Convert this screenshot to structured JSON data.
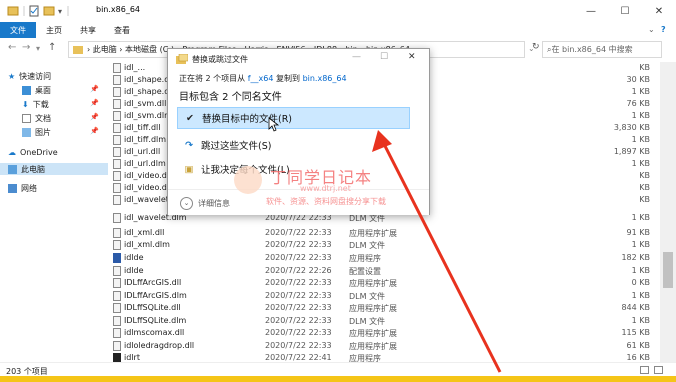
{
  "window": {
    "title": "bin.x86_64",
    "controls": {
      "minimize": "—",
      "maximize": "☐",
      "close": "✕"
    }
  },
  "ribbon": {
    "file_tab": "文件",
    "tabs": [
      "主页",
      "共享",
      "查看"
    ]
  },
  "address": {
    "path": "› 此电脑 › 本地磁盘 (C:) › Program Files › Harris › ENVI56 › IDL88 › bin › bin.x86_64",
    "search_placeholder": "在 bin.x86_64 中搜索"
  },
  "sidebar": {
    "items": [
      {
        "label": "快速访问",
        "icon": "star-icon"
      },
      {
        "label": "桌面",
        "icon": "desktop-icon"
      },
      {
        "label": "下载",
        "icon": "download-icon"
      },
      {
        "label": "文档",
        "icon": "document-icon"
      },
      {
        "label": "图片",
        "icon": "picture-icon"
      },
      {
        "label": "OneDrive",
        "icon": "cloud-icon"
      },
      {
        "label": "此电脑",
        "icon": "computer-icon"
      },
      {
        "label": "网络",
        "icon": "network-icon"
      }
    ],
    "pin_glyph": "📌"
  },
  "files": [
    {
      "name": "idl_...",
      "date": "",
      "type": "",
      "size": "KB"
    },
    {
      "name": "idl_shape.dll",
      "date": "",
      "type": "",
      "size": "30 KB"
    },
    {
      "name": "idl_shape.dlm",
      "date": "",
      "type": "",
      "size": "1 KB"
    },
    {
      "name": "idl_svm.dll",
      "date": "",
      "type": "",
      "size": "76 KB"
    },
    {
      "name": "idl_svm.dlm",
      "date": "",
      "type": "",
      "size": "1 KB"
    },
    {
      "name": "idl_tiff.dll",
      "date": "",
      "type": "",
      "size": "3,830 KB"
    },
    {
      "name": "idl_tiff.dlm",
      "date": "",
      "type": "",
      "size": "1 KB"
    },
    {
      "name": "idl_url.dll",
      "date": "",
      "type": "",
      "size": "1,897 KB"
    },
    {
      "name": "idl_url.dlm",
      "date": "",
      "type": "",
      "size": "1 KB"
    },
    {
      "name": "idl_video.dll",
      "date": "",
      "type": "",
      "size": "KB"
    },
    {
      "name": "idl_video.dlm",
      "date": "",
      "type": "",
      "size": "KB"
    },
    {
      "name": "idl_wavelet...",
      "date": "",
      "type": "",
      "size": "KB"
    },
    {
      "name": "idl_wavelet.dlm",
      "date": "2020/7/22 22:33",
      "type": "DLM 文件",
      "size": "1 KB"
    },
    {
      "name": "idl_xml.dll",
      "date": "2020/7/22 22:33",
      "type": "应用程序扩展",
      "size": "91 KB"
    },
    {
      "name": "idl_xml.dlm",
      "date": "2020/7/22 22:33",
      "type": "DLM 文件",
      "size": "1 KB"
    },
    {
      "name": "idlde",
      "date": "2020/7/22 22:33",
      "type": "应用程序",
      "size": "182 KB"
    },
    {
      "name": "idlde",
      "date": "2020/7/22 22:26",
      "type": "配置设置",
      "size": "1 KB"
    },
    {
      "name": "IDLffArcGIS.dll",
      "date": "2020/7/22 22:33",
      "type": "应用程序扩展",
      "size": "0 KB"
    },
    {
      "name": "IDLffArcGIS.dlm",
      "date": "2020/7/22 22:33",
      "type": "DLM 文件",
      "size": "1 KB"
    },
    {
      "name": "IDLffSQLite.dll",
      "date": "2020/7/22 22:33",
      "type": "应用程序扩展",
      "size": "844 KB"
    },
    {
      "name": "IDLffSQLite.dlm",
      "date": "2020/7/22 22:33",
      "type": "DLM 文件",
      "size": "1 KB"
    },
    {
      "name": "idlmscomax.dll",
      "date": "2020/7/22 22:33",
      "type": "应用程序扩展",
      "size": "115 KB"
    },
    {
      "name": "idloledragdrop.dll",
      "date": "2020/7/22 22:33",
      "type": "应用程序扩展",
      "size": "61 KB"
    },
    {
      "name": "idlrt",
      "date": "2020/7/22 22:41",
      "type": "应用程序",
      "size": "16 KB"
    }
  ],
  "status": {
    "count": "203 个项目"
  },
  "dialog": {
    "title": "替换或跳过文件",
    "line1_prefix": "正在将 2 个项目从",
    "line1_src": "f__x64",
    "line1_mid": "复制到",
    "line1_dst": "bin.x86_64",
    "line2": "目标包含 2 个同名文件",
    "options": [
      {
        "label": "替换目标中的文件(R)",
        "icon": "checkmark-icon",
        "glyph": "✔"
      },
      {
        "label": "跳过这些文件(S)",
        "icon": "skip-icon",
        "glyph": "↷"
      },
      {
        "label": "让我决定每个文件(L)",
        "icon": "decide-icon",
        "glyph": "▣"
      }
    ],
    "details": "详细信息",
    "controls": {
      "minimize": "—",
      "maximize": "☐",
      "close": "✕"
    }
  },
  "watermark": {
    "title": "丁同学日记本",
    "url": "www.dtrj.net",
    "subtitle": "软件、资源、资料网盘搜分享下载"
  },
  "colors": {
    "accent": "#1979ca",
    "arrow": "#e8321e",
    "selection": "#cce8ff"
  }
}
